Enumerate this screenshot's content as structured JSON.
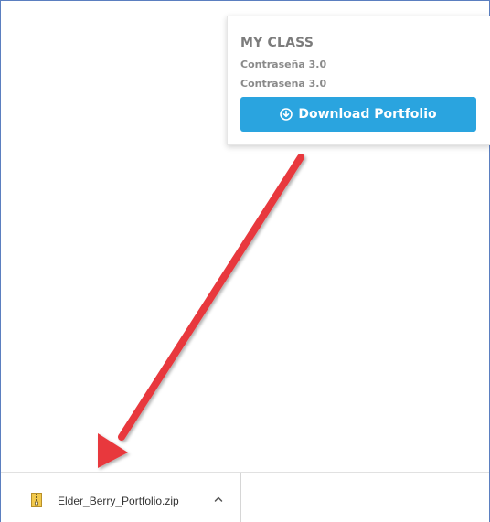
{
  "card": {
    "title": "MY CLASS",
    "line1": "Contraseña 3.0",
    "line2": "Contraseña 3.0",
    "download_label": "Download Portfolio",
    "button_color": "#2aa4df"
  },
  "download_bar": {
    "file_name": "Elder_Berry_Portfolio.zip",
    "file_icon": "zip-file-icon",
    "menu_icon": "chevron-up-icon"
  },
  "annotation": {
    "arrow_color": "#e8383d"
  }
}
